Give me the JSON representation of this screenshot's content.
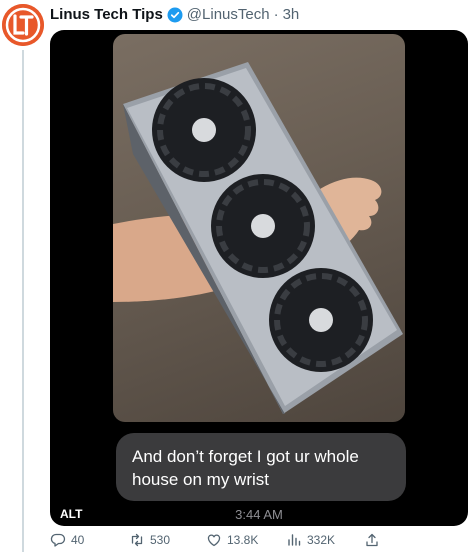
{
  "tweet": {
    "author_name": "Linus Tech Tips",
    "handle": "@LinusTech",
    "separator": "·",
    "time": "3h",
    "avatar_initials": "LT",
    "media": {
      "caption": "And don’t forget I got ur whole house on my wrist",
      "alt_badge": "ALT",
      "message_time": "3:44 AM"
    },
    "actions": {
      "replies": "40",
      "retweets": "530",
      "likes": "13.8K",
      "views": "332K"
    }
  },
  "colors": {
    "accent": "#1d9bf0",
    "brand": "#e8582a",
    "text_secondary": "#536471"
  }
}
